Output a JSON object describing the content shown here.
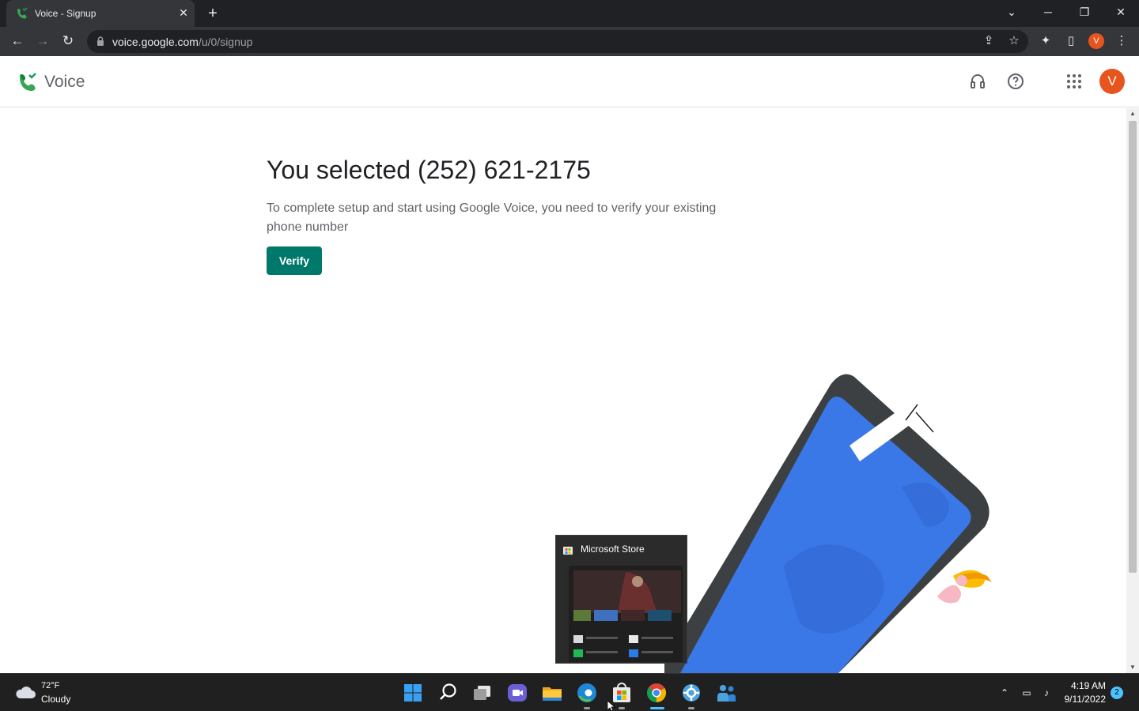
{
  "browser": {
    "tab_title": "Voice - Signup",
    "tab_close": "✕",
    "new_tab": "+",
    "url_host": "voice.google.com",
    "url_path": "/u/0/signup",
    "profile_initial": "V"
  },
  "app": {
    "name": "Voice",
    "avatar_initial": "V",
    "accent_color": "#00796b"
  },
  "main": {
    "heading": "You selected (252) 621-2175",
    "description": "To complete setup and start using Google Voice, you need to verify your existing phone number",
    "verify_label": "Verify"
  },
  "preview": {
    "title": "Microsoft Store"
  },
  "taskbar": {
    "weather_temp": "72°F",
    "weather_desc": "Cloudy",
    "time": "4:19 AM",
    "date": "9/11/2022",
    "notification_count": "2"
  }
}
